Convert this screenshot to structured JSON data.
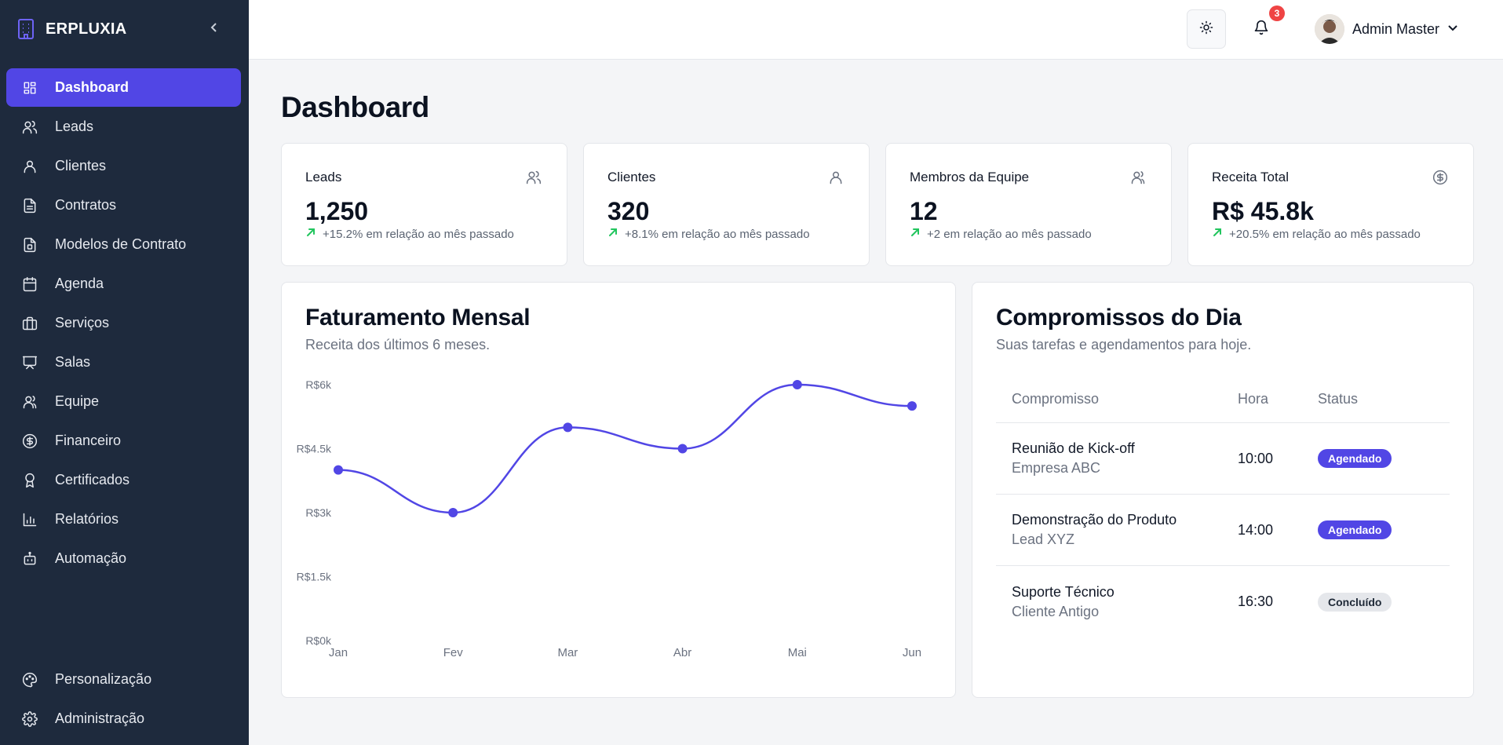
{
  "brand": {
    "name": "ERPLUXIA"
  },
  "sidebar": {
    "items": [
      {
        "label": "Dashboard",
        "icon": "dashboard-icon",
        "active": true
      },
      {
        "label": "Leads",
        "icon": "users-icon"
      },
      {
        "label": "Clientes",
        "icon": "user-icon"
      },
      {
        "label": "Contratos",
        "icon": "file-text-icon"
      },
      {
        "label": "Modelos de Contrato",
        "icon": "file-template-icon"
      },
      {
        "label": "Agenda",
        "icon": "calendar-icon"
      },
      {
        "label": "Serviços",
        "icon": "briefcase-icon"
      },
      {
        "label": "Salas",
        "icon": "presentation-icon"
      },
      {
        "label": "Equipe",
        "icon": "team-icon"
      },
      {
        "label": "Financeiro",
        "icon": "dollar-circle-icon"
      },
      {
        "label": "Certificados",
        "icon": "award-icon"
      },
      {
        "label": "Relatórios",
        "icon": "bar-chart-icon"
      },
      {
        "label": "Automação",
        "icon": "bot-icon"
      }
    ],
    "bottom_items": [
      {
        "label": "Personalização",
        "icon": "palette-icon"
      },
      {
        "label": "Administração",
        "icon": "settings-icon"
      }
    ]
  },
  "header": {
    "notifications_count": "3",
    "user_name": "Admin Master"
  },
  "page": {
    "title": "Dashboard"
  },
  "stats": [
    {
      "label": "Leads",
      "value": "1,250",
      "trend": "+15.2% em relação ao mês passado",
      "icon": "users-icon"
    },
    {
      "label": "Clientes",
      "value": "320",
      "trend": "+8.1% em relação ao mês passado",
      "icon": "user-icon"
    },
    {
      "label": "Membros da Equipe",
      "value": "12",
      "trend": "+2 em relação ao mês passado",
      "icon": "team-icon"
    },
    {
      "label": "Receita Total",
      "value": "R$ 45.8k",
      "trend": "+20.5% em relação ao mês passado",
      "icon": "dollar-circle-icon"
    }
  ],
  "revenue": {
    "title": "Faturamento Mensal",
    "subtitle": "Receita dos últimos 6 meses."
  },
  "chart_data": {
    "type": "line",
    "categories": [
      "Jan",
      "Fev",
      "Mar",
      "Abr",
      "Mai",
      "Jun"
    ],
    "values": [
      4000,
      3000,
      5000,
      4500,
      6000,
      5500
    ],
    "ylim": [
      0,
      6000
    ],
    "yticks": [
      0,
      1500,
      3000,
      4500,
      6000
    ],
    "ytick_labels": [
      "R$0k",
      "R$1.5k",
      "R$3k",
      "R$4.5k",
      "R$6k"
    ],
    "color": "#5146e5",
    "grid": false,
    "smooth": true
  },
  "appointments": {
    "title": "Compromissos do Dia",
    "subtitle": "Suas tarefas e agendamentos para hoje.",
    "columns": [
      "Compromisso",
      "Hora",
      "Status"
    ],
    "rows": [
      {
        "title": "Reunião de Kick-off",
        "sub": "Empresa ABC",
        "time": "10:00",
        "status": "Agendado",
        "kind": "sched"
      },
      {
        "title": "Demonstração do Produto",
        "sub": "Lead XYZ",
        "time": "14:00",
        "status": "Agendado",
        "kind": "sched"
      },
      {
        "title": "Suporte Técnico",
        "sub": "Cliente Antigo",
        "time": "16:30",
        "status": "Concluído",
        "kind": "done"
      }
    ]
  },
  "colors": {
    "sidebar_bg": "#1e2a3d",
    "accent": "#5146e5",
    "trend_up": "#22c55e",
    "badge": "#ef4444"
  }
}
